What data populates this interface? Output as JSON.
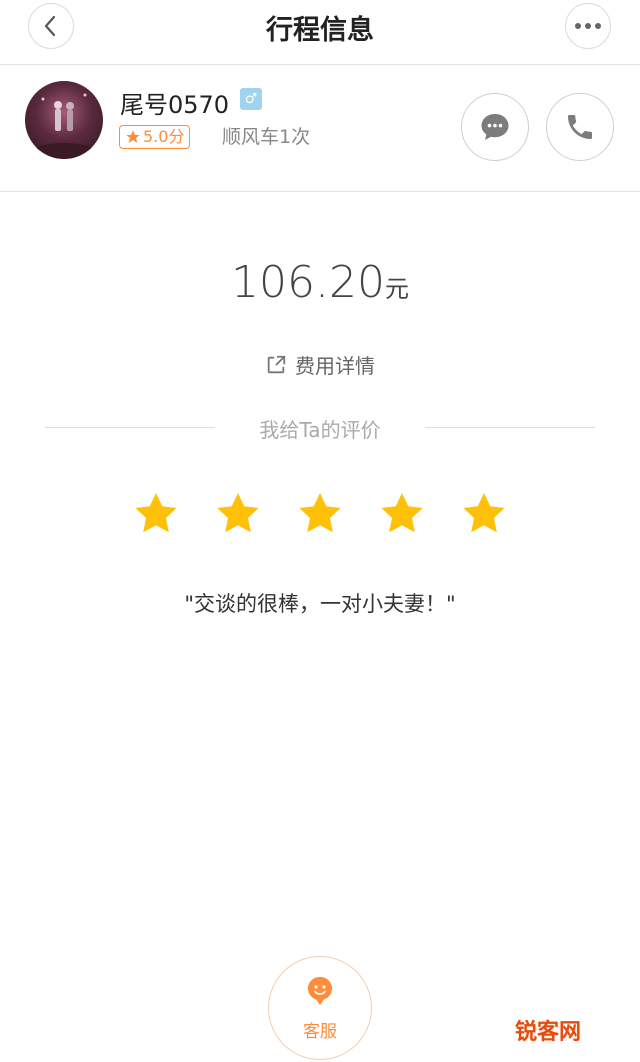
{
  "header": {
    "title": "行程信息",
    "back_icon": "chevron-left-icon",
    "more_icon": "more-dots-icon"
  },
  "driver": {
    "name": "尾号0570",
    "gender_symbol": "♂",
    "rating": "5.0分",
    "rides": "顺风车1次"
  },
  "fare": {
    "amount": "106.20",
    "unit": "元",
    "details_link": "费用详情"
  },
  "review": {
    "label": "我给Ta的评价",
    "stars": 5,
    "stars_max": 5,
    "comment": "\"交谈的很棒，一对小夫妻！\""
  },
  "service": {
    "label": "客服"
  },
  "watermark": "锐客网",
  "colors": {
    "accent": "#ff8c3b",
    "star": "#ffc107",
    "gender_badge": "#9fd3f0"
  }
}
